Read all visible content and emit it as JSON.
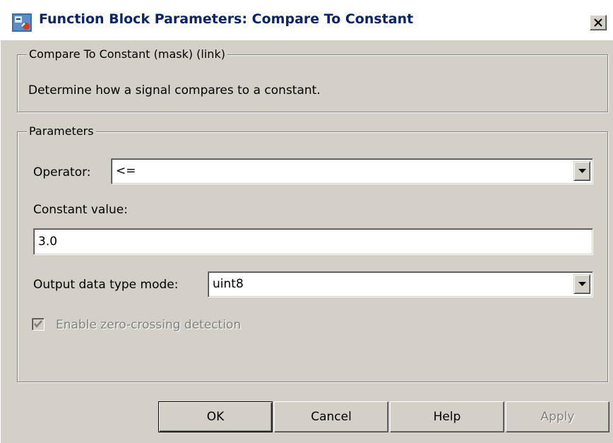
{
  "window": {
    "title": "Function Block Parameters: Compare To Constant",
    "icon": "simulink-block-icon",
    "close_icon": "close-icon"
  },
  "description": {
    "group_label": "Compare To Constant (mask) (link)",
    "text": "Determine how a signal compares to a constant."
  },
  "parameters": {
    "group_label": "Parameters",
    "operator_label": "Operator:",
    "operator_value": "<=",
    "constant_label": "Constant value:",
    "constant_value": "3.0",
    "output_type_label": "Output data type mode:",
    "output_type_value": "uint8",
    "zero_crossing_label": "Enable zero-crossing detection",
    "zero_crossing_checked": true,
    "zero_crossing_enabled": false
  },
  "buttons": {
    "ok": "OK",
    "cancel": "Cancel",
    "help": "Help",
    "apply": "Apply",
    "apply_enabled": false
  },
  "colors": {
    "dialog_bg": "#d4d0c8",
    "title_text": "#0a246a",
    "disabled_text": "#808080"
  }
}
